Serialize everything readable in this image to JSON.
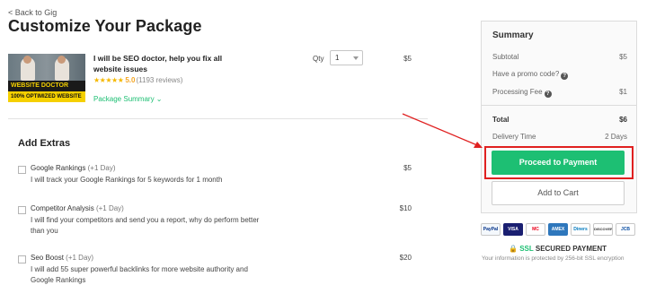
{
  "header": {
    "back_link": "< Back to Gig",
    "title": "Customize Your Package"
  },
  "gig": {
    "thumbnail_banner_top": "WEBSITE DOCTOR",
    "thumbnail_banner_bottom": "100% OPTIMIZED WEBSITE",
    "title": "I will be SEO doctor, help you fix all website issues",
    "stars": "★★★★★",
    "rating": "5.0",
    "reviews": "(1193 reviews)",
    "package_summary": "Package Summary ⌄",
    "qty_label": "Qty",
    "qty_value": "1",
    "price": "$5"
  },
  "extras": {
    "title": "Add Extras",
    "items": [
      {
        "name": "Google Rankings",
        "days": "(+1 Day)",
        "desc": "I will track your Google Rankings for 5 keywords for 1 month",
        "price": "$5"
      },
      {
        "name": "Competitor Analysis",
        "days": "(+1 Day)",
        "desc": "I will find your competitors and send you a report, why do perform better than you",
        "price": "$10"
      },
      {
        "name": "Seo Boost",
        "days": "(+1 Day)",
        "desc": "I will add 55 super powerful backlinks for more website authority and Google Rankings",
        "price": "$20"
      }
    ]
  },
  "summary": {
    "title": "Summary",
    "subtotal_label": "Subtotal",
    "subtotal_value": "$5",
    "promo_label": "Have a promo code?",
    "fee_label": "Processing Fee",
    "fee_value": "$1",
    "total_label": "Total",
    "total_value": "$6",
    "delivery_label": "Delivery Time",
    "delivery_value": "2 Days",
    "proceed_label": "Proceed to Payment",
    "cart_label": "Add to Cart"
  },
  "payment": {
    "methods": [
      "PayPal",
      "VISA",
      "MC",
      "AMEX",
      "Diners",
      "DISCOVER",
      "JCB"
    ],
    "ssl_label": "SSL",
    "ssl_text": "SECURED PAYMENT",
    "ssl_note": "Your information is protected by 256-bit SSL encryption"
  },
  "colors": {
    "accent_green": "#1dbf73",
    "highlight_red": "#e02020",
    "star_gold": "#f5b800"
  }
}
